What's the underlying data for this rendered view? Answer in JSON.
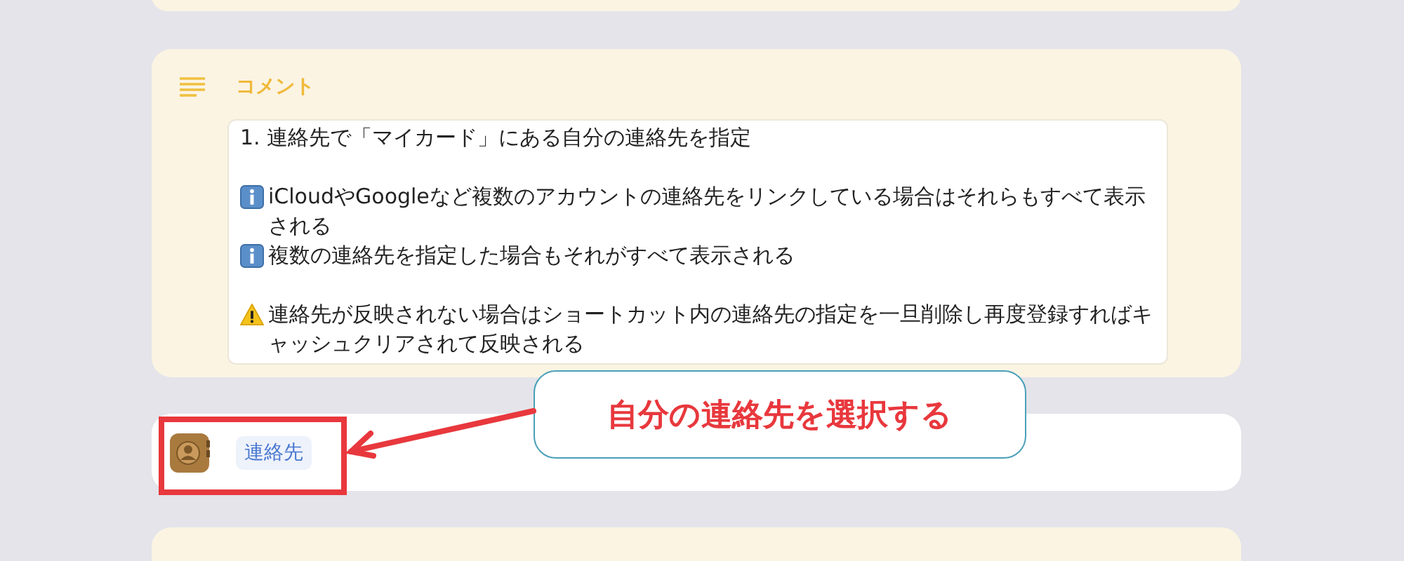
{
  "blocks": [
    {
      "kind": "comment_stub"
    },
    {
      "kind": "comment",
      "title": "コメント",
      "paragraphs": [
        {
          "lines": [
            {
              "kind": "text",
              "text": "1. 連絡先で「マイカード」にある自分の連絡先を指定"
            }
          ]
        },
        {
          "lines": [
            {
              "kind": "info",
              "text": "iCloudやGoogleなど複数のアカウントの連絡先をリンクしている場合はそれらもすべて表示される"
            },
            {
              "kind": "info",
              "text": "複数の連絡先を指定した場合もそれがすべて表示される"
            }
          ]
        },
        {
          "lines": [
            {
              "kind": "warning",
              "text": "連絡先が反映されない場合はショートカット内の連絡先の指定を一旦削除し再度登録すればキャッシュクリアされて反映される"
            }
          ]
        }
      ]
    },
    {
      "kind": "action",
      "label": "連絡先",
      "highlighted": true
    },
    {
      "kind": "comment_stub"
    }
  ],
  "annotation": {
    "callout": "自分の連絡先を選択する"
  }
}
